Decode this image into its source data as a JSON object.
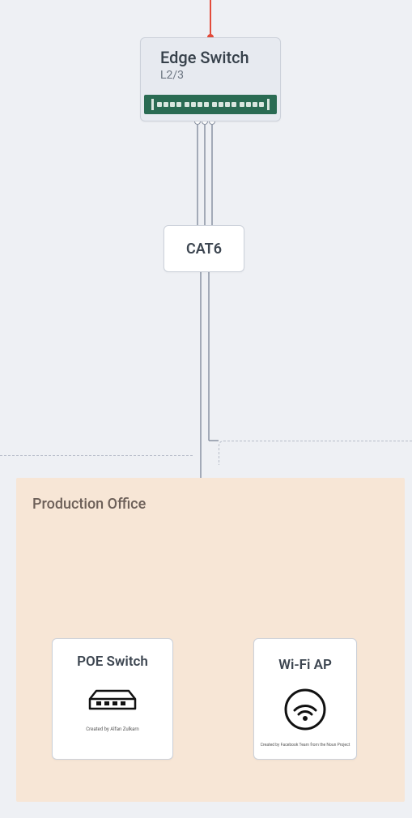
{
  "nodes": {
    "edge_switch": {
      "title": "Edge Switch",
      "subtitle": "L2/3"
    },
    "cat6": {
      "title": "CAT6"
    },
    "poe": {
      "title": "POE Switch",
      "credit": "Created by Alfan Zulkarn"
    },
    "wifi": {
      "title": "Wi-Fi AP",
      "credit": "Created by Facebook Team from the Noun Project"
    }
  },
  "zone": {
    "label": "Production Office"
  },
  "colors": {
    "uplink": "#e24b3a",
    "wire": "#8a93a3",
    "switch_body": "#2a6b53"
  }
}
